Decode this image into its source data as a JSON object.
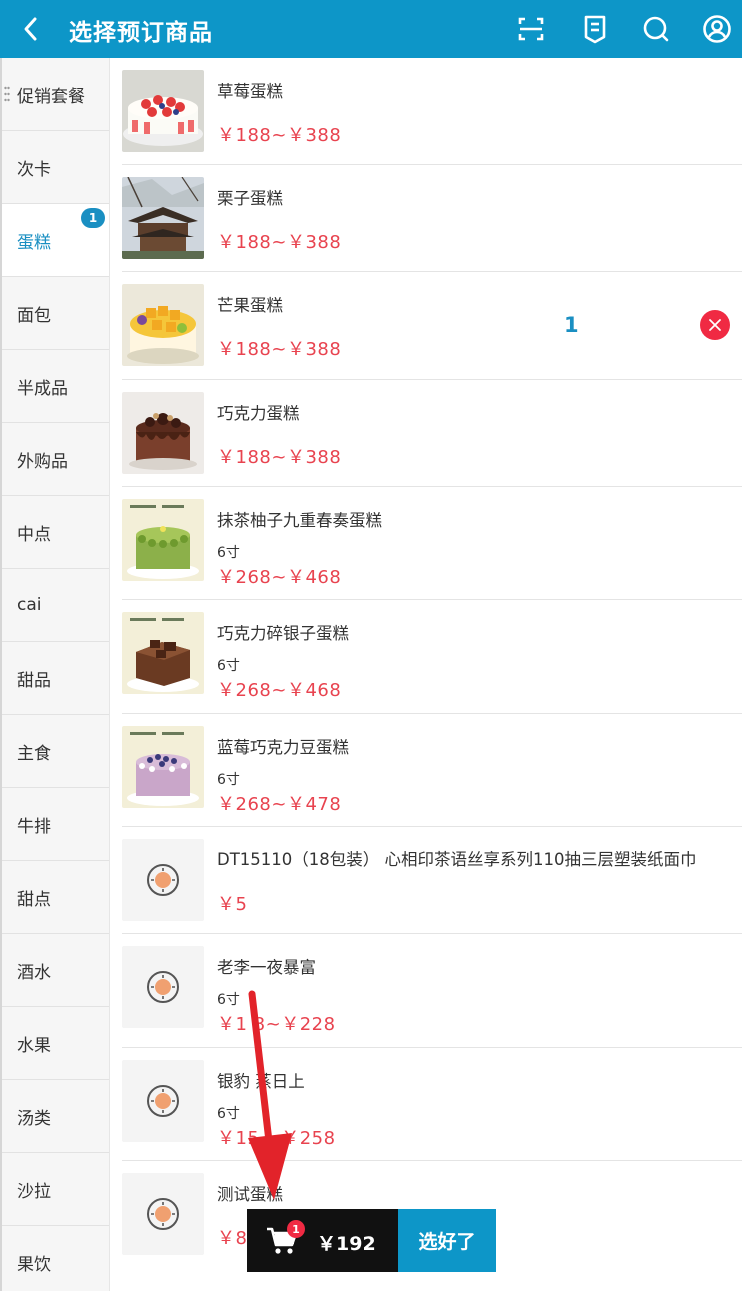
{
  "header": {
    "title": "选择预订商品",
    "icons": [
      "back-icon",
      "scan-icon",
      "order-list-icon",
      "search-icon",
      "user-icon"
    ]
  },
  "sidebar": {
    "items": [
      {
        "label": "促销套餐"
      },
      {
        "label": "次卡"
      },
      {
        "label": "蛋糕",
        "badge": "1",
        "active": true
      },
      {
        "label": "面包"
      },
      {
        "label": "半成品"
      },
      {
        "label": "外购品"
      },
      {
        "label": "中点"
      },
      {
        "label": "cai"
      },
      {
        "label": "甜品"
      },
      {
        "label": "主食"
      },
      {
        "label": "牛排"
      },
      {
        "label": "甜点"
      },
      {
        "label": "酒水"
      },
      {
        "label": "水果"
      },
      {
        "label": "汤类"
      },
      {
        "label": "沙拉"
      },
      {
        "label": "果饮"
      }
    ]
  },
  "products": [
    {
      "name": "草莓蛋糕",
      "spec": "",
      "price": "￥188~￥388",
      "image": "strawberry-cake"
    },
    {
      "name": "栗子蛋糕",
      "spec": "",
      "price": "￥188~￥388",
      "image": "pavilion-photo"
    },
    {
      "name": "芒果蛋糕",
      "spec": "",
      "price": "￥188~￥388",
      "image": "mango-cake",
      "quantity": "1"
    },
    {
      "name": "巧克力蛋糕",
      "spec": "",
      "price": "￥188~￥388",
      "image": "chocolate-cake"
    },
    {
      "name": "抹茶柚子九重春奏蛋糕",
      "spec": "6寸",
      "price": "￥268~￥468",
      "image": "matcha-cake"
    },
    {
      "name": "巧克力碎银子蛋糕",
      "spec": "6寸",
      "price": "￥268~￥468",
      "image": "chocolate-square-cake"
    },
    {
      "name": "蓝莓巧克力豆蛋糕",
      "spec": "6寸",
      "price": "￥268~￥478",
      "image": "blueberry-cake"
    },
    {
      "name": "DT15110（18包装） 心相印茶语丝享系列110抽三层塑装纸面巾",
      "spec": "",
      "price": "￥5",
      "image": "placeholder"
    },
    {
      "name": "老李一夜暴富",
      "spec": "6寸",
      "price": "￥1 8~￥228",
      "image": "placeholder"
    },
    {
      "name": "银豹 蒸日上",
      "spec": "6寸",
      "price": "￥15 ~￥258",
      "image": "placeholder"
    },
    {
      "name": "测试蛋糕",
      "spec": "",
      "price": "￥8",
      "image": "placeholder"
    }
  ],
  "cart": {
    "count": "1",
    "total": "￥192",
    "checkout_label": "选好了"
  },
  "colors": {
    "primary": "#0d96c8",
    "price": "#e8434f",
    "remove": "#f02a43",
    "annotation_arrow": "#e2232a"
  }
}
